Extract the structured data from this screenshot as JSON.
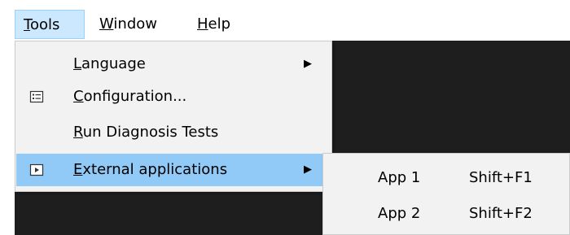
{
  "menubar": {
    "items": [
      {
        "label_rest": "ools",
        "accel": "T"
      },
      {
        "label_rest": "indow",
        "accel": "W"
      },
      {
        "label_rest": "elp",
        "accel": "H"
      }
    ]
  },
  "tools_menu": {
    "items": [
      {
        "accel": "L",
        "rest": "anguage",
        "has_submenu": true,
        "icon": null
      },
      {
        "accel": "C",
        "rest": "onfiguration...",
        "has_submenu": false,
        "icon": "configuration-icon"
      },
      {
        "accel": "R",
        "rest": "un Diagnosis Tests",
        "has_submenu": false,
        "icon": null
      },
      {
        "accel": "E",
        "rest": "xternal applications",
        "has_submenu": true,
        "icon": "external-app-icon",
        "highlighted": true
      }
    ],
    "arrow_glyph": "▶"
  },
  "external_submenu": {
    "items": [
      {
        "label": "App 1",
        "shortcut": "Shift+F1"
      },
      {
        "label": "App 2",
        "shortcut": "Shift+F2"
      }
    ]
  },
  "colors": {
    "menubar_active_bg": "#cce8ff",
    "highlight_bg": "#91c9f7",
    "menu_bg": "#f2f2f2",
    "app_bg": "#1e1e1e"
  }
}
